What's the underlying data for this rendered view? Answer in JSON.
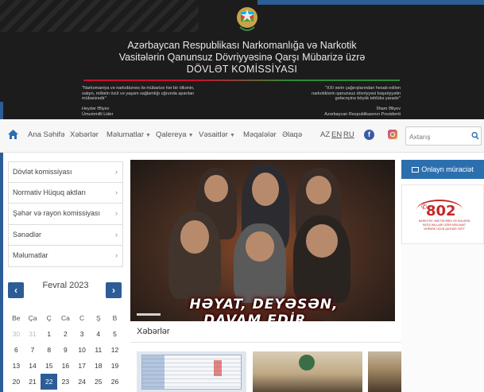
{
  "header": {
    "title_line1": "Azərbaycan Respublikası Narkomanlığa və Narkotik",
    "title_line2": "Vasitələrin Qanunsuz Dövriyyəsinə Qarşı Mübarizə üzrə",
    "title_line3": "DÖVLƏT KOMİSSİYASI",
    "quote_left": "\"Narkomaniya və narkobiznes ilə mübarizə hər bir ölkənin, xalqın, millətin özül və yaşam sağlamlığı uğrunda aparılan mübarizədir\"",
    "author_left_name": "Heydər Əliyev",
    "author_left_role": "Ümummilli Lider",
    "quote_right": "\"XXI əsrin çağırışlarından hesab edilən narkotiklərin qanunsuz dövriyyəsi bəşəriyyətin gələcəyinə böyük təhlükə yaradır\"",
    "author_right_name": "İlham Əliyev",
    "author_right_role": "Azərbaycan Respublikasının Prezidenti",
    "flag_colors": [
      "#00b5e2",
      "#ef3340",
      "#509e2f"
    ]
  },
  "nav": {
    "home_icon": "home-icon",
    "items": [
      {
        "label": "Ana Səhifə",
        "dropdown": false
      },
      {
        "label": "Xəbərlər",
        "dropdown": false
      },
      {
        "label": "Məlumatlar",
        "dropdown": true
      },
      {
        "label": "Qalereya",
        "dropdown": true
      },
      {
        "label": "Vəsaitlər",
        "dropdown": true
      },
      {
        "label": "Məqalələr",
        "dropdown": false
      },
      {
        "label": "Əlaqə",
        "dropdown": false
      }
    ],
    "languages": [
      "AZ",
      "EN",
      "RU"
    ],
    "facebook_glyph": "f",
    "search_placeholder": "Axtarış"
  },
  "sidebar": {
    "items": [
      {
        "label": "Dövlət komissiyası"
      },
      {
        "label": "Normativ Hüquq aktları"
      },
      {
        "label": "Şəhər və rayon komissiyası"
      },
      {
        "label": "Sənədlər"
      },
      {
        "label": "Məlumatlar"
      }
    ]
  },
  "calendar": {
    "month_label": "Fevral 2023",
    "prev_glyph": "‹",
    "next_glyph": "›",
    "weekdays": [
      "Be",
      "Ça",
      "Ç",
      "Ca",
      "C",
      "Ş",
      "B"
    ],
    "weeks": [
      [
        {
          "d": "30",
          "muted": true
        },
        {
          "d": "31",
          "muted": true
        },
        {
          "d": "1"
        },
        {
          "d": "2"
        },
        {
          "d": "3"
        },
        {
          "d": "4"
        },
        {
          "d": "5"
        }
      ],
      [
        {
          "d": "6"
        },
        {
          "d": "7"
        },
        {
          "d": "8"
        },
        {
          "d": "9"
        },
        {
          "d": "10"
        },
        {
          "d": "11"
        },
        {
          "d": "12"
        }
      ],
      [
        {
          "d": "13"
        },
        {
          "d": "14"
        },
        {
          "d": "15"
        },
        {
          "d": "16"
        },
        {
          "d": "17"
        },
        {
          "d": "18"
        },
        {
          "d": "19"
        }
      ],
      [
        {
          "d": "20"
        },
        {
          "d": "21"
        },
        {
          "d": "22",
          "today": true
        },
        {
          "d": "23"
        },
        {
          "d": "24"
        },
        {
          "d": "25"
        },
        {
          "d": "26"
        }
      ]
    ]
  },
  "slider": {
    "caption": "HƏYAT, DEYƏSƏN, DAVAM EDİR..."
  },
  "news": {
    "section_title": "Xəbərlər"
  },
  "right": {
    "online_button": "Onlayn müraciət",
    "hotline_number": "802",
    "hotline_subtext": "NARKOTİK VASİTƏLƏRİN VƏ ONLARIN SATIŞ HALLARI ÜZRƏ MƏLUMAT VERMƏK ÜÇÜN QAYNAR XƏTT"
  },
  "colors": {
    "accent": "#2c5d96",
    "button_blue": "#2c6fae",
    "hotline_red": "#c62828"
  }
}
